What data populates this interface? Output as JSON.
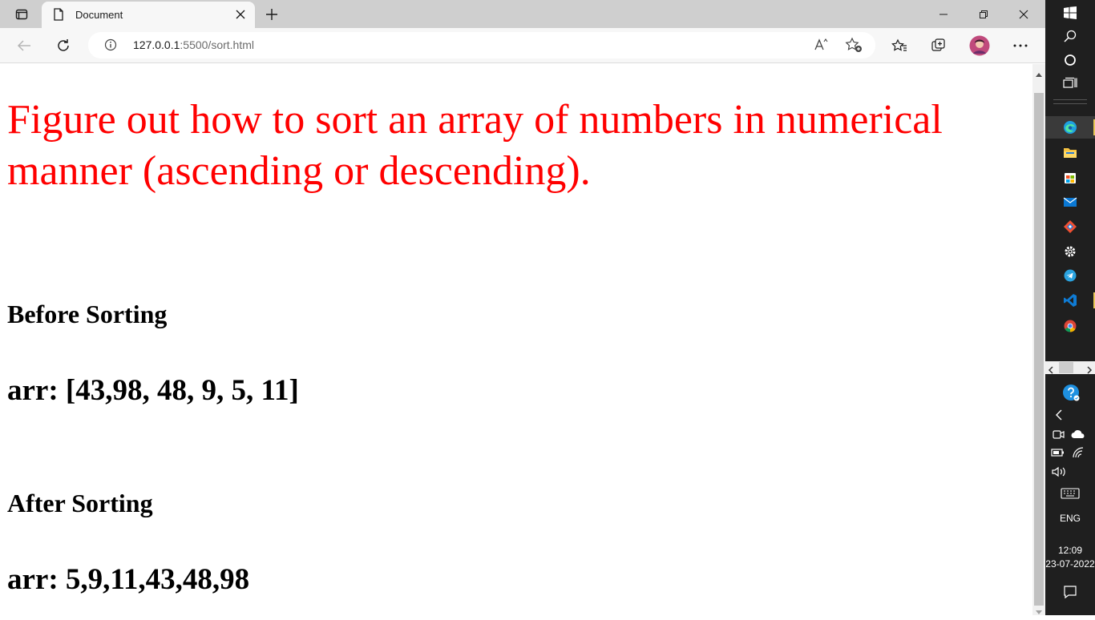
{
  "browser": {
    "tab": {
      "title": "Document"
    },
    "address": {
      "host": "127.0.0.1",
      "rest": ":5500/sort.html"
    }
  },
  "page": {
    "heading": "Figure out how to sort an array of numbers in numerical manner (ascending or descending).",
    "before_label": "Before Sorting",
    "before_array": "arr: [43,98, 48, 9, 5, 11]",
    "after_label": "After Sorting",
    "after_array": "arr: 5,9,11,43,48,98"
  },
  "taskbar": {
    "language": "ENG",
    "time": "12:09",
    "date": "23-07-2022"
  },
  "colors": {
    "heading": "#ff0000",
    "taskbar_bg": "#1f1f1f"
  }
}
